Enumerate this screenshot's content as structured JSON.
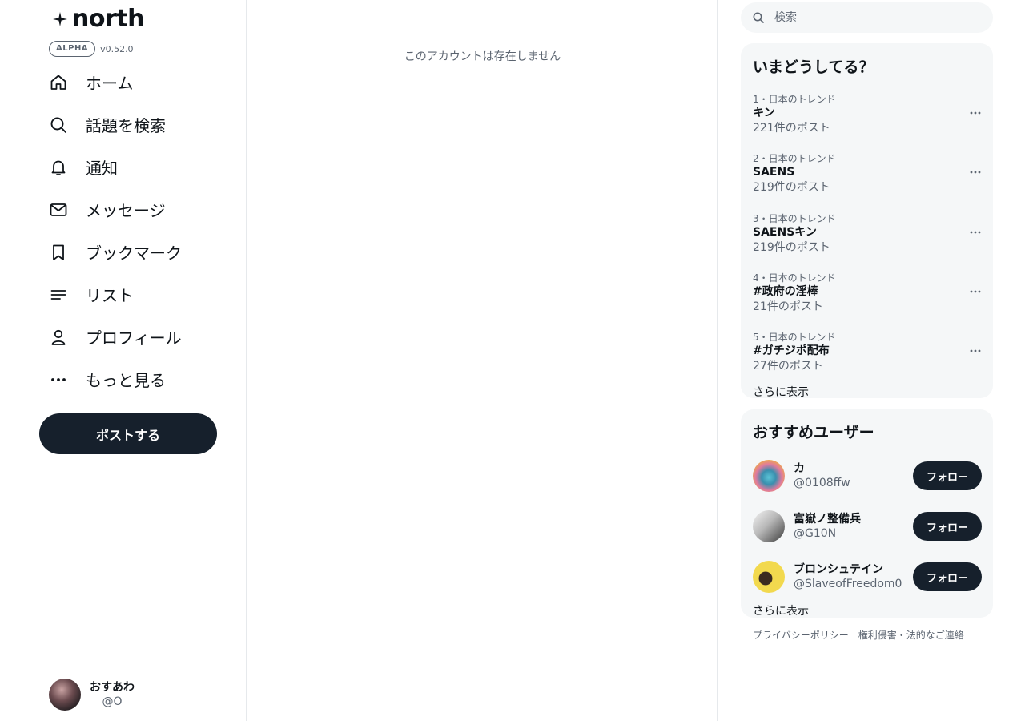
{
  "brand": {
    "name": "north",
    "badge": "ALPHA",
    "version": "v0.52.0"
  },
  "nav": [
    {
      "id": "home",
      "label": "ホーム",
      "icon": "home-icon"
    },
    {
      "id": "explore",
      "label": "話題を検索",
      "icon": "search-icon"
    },
    {
      "id": "notifications",
      "label": "通知",
      "icon": "bell-icon"
    },
    {
      "id": "messages",
      "label": "メッセージ",
      "icon": "envelope-icon"
    },
    {
      "id": "bookmarks",
      "label": "ブックマーク",
      "icon": "bookmark-icon"
    },
    {
      "id": "lists",
      "label": "リスト",
      "icon": "list-icon"
    },
    {
      "id": "profile",
      "label": "プロフィール",
      "icon": "user-icon"
    },
    {
      "id": "more",
      "label": "もっと見る",
      "icon": "more-icon"
    }
  ],
  "post_button": "ポストする",
  "current_user": {
    "name": "おすあわ",
    "handle": "@O"
  },
  "main": {
    "empty_message": "このアカウントは存在しません"
  },
  "search": {
    "placeholder": "検索"
  },
  "trends": {
    "title": "いまどうしてる？",
    "items": [
      {
        "meta": "1・日本のトレンド",
        "name": "キン",
        "count": "221件のポスト"
      },
      {
        "meta": "2・日本のトレンド",
        "name": "SAENS",
        "count": "219件のポスト"
      },
      {
        "meta": "3・日本のトレンド",
        "name": "SAENSキン",
        "count": "219件のポスト"
      },
      {
        "meta": "4・日本のトレンド",
        "name": "#政府の淫棒",
        "count": "21件のポスト"
      },
      {
        "meta": "5・日本のトレンド",
        "name": "#ガチジポ配布",
        "count": "27件のポスト"
      }
    ],
    "show_more": "さらに表示"
  },
  "recommended": {
    "title": "おすすめユーザー",
    "users": [
      {
        "name": "カ",
        "handle": "@0108ffw",
        "follow_label": "フォロー"
      },
      {
        "name": "富嶽ノ整備兵",
        "handle": "@G10N",
        "follow_label": "フォロー"
      },
      {
        "name": "ブロンシュテイン",
        "handle": "@SlaveofFreedom0",
        "follow_label": "フォロー"
      }
    ],
    "show_more": "さらに表示"
  },
  "footer": {
    "privacy": "プライバシーポリシー",
    "copyright": "権利侵害・法的なご連絡"
  },
  "colors": {
    "primary": "#16202c",
    "muted": "#5b6470",
    "panel": "#f5f7f8",
    "border": "#e6e9ec"
  }
}
